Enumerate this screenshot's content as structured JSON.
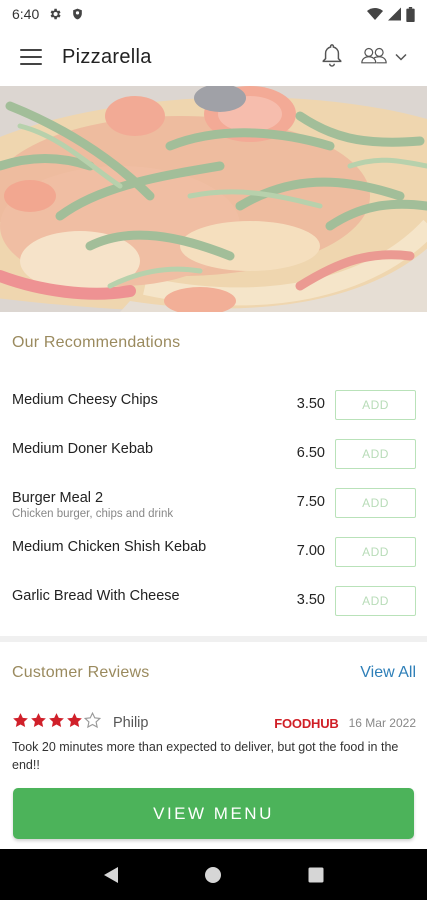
{
  "status_bar": {
    "time": "6:40",
    "icons": [
      "gear-icon",
      "shield-icon",
      "wifi-icon",
      "signal-icon",
      "battery-icon"
    ]
  },
  "app_bar": {
    "title": "Pizzarella",
    "icons": [
      "menu-icon",
      "bell-icon",
      "language-icon",
      "chevron-down-icon"
    ]
  },
  "recommendations": {
    "title": "Our Recommendations",
    "add_label": "ADD",
    "items": [
      {
        "name": "Medium Cheesy Chips",
        "description": "",
        "price": "3.50"
      },
      {
        "name": "Medium Doner Kebab",
        "description": "",
        "price": "6.50"
      },
      {
        "name": "Burger Meal 2",
        "description": "Chicken burger, chips and drink",
        "price": "7.50"
      },
      {
        "name": "Medium Chicken Shish Kebab",
        "description": "",
        "price": "7.00"
      },
      {
        "name": "Garlic Bread With Cheese",
        "description": "",
        "price": "3.50"
      }
    ]
  },
  "reviews": {
    "title": "Customer Reviews",
    "view_all": "View All",
    "items": [
      {
        "rating": 4,
        "max_rating": 5,
        "reviewer": "Philip",
        "source": "FOODHUB",
        "date": "16 Mar 2022",
        "text": "Took 20 minutes more than expected to deliver, but got the food in the end!!"
      }
    ]
  },
  "cta": {
    "label": "VIEW MENU"
  },
  "nav_bar": {
    "icons": [
      "back-icon",
      "home-icon",
      "recents-icon"
    ]
  },
  "colors": {
    "accent_green": "#4cb35a",
    "section_title": "#9a8a5e",
    "link_blue": "#2e7fb8",
    "star_red": "#d0202a",
    "brand_red": "#d01f26"
  }
}
